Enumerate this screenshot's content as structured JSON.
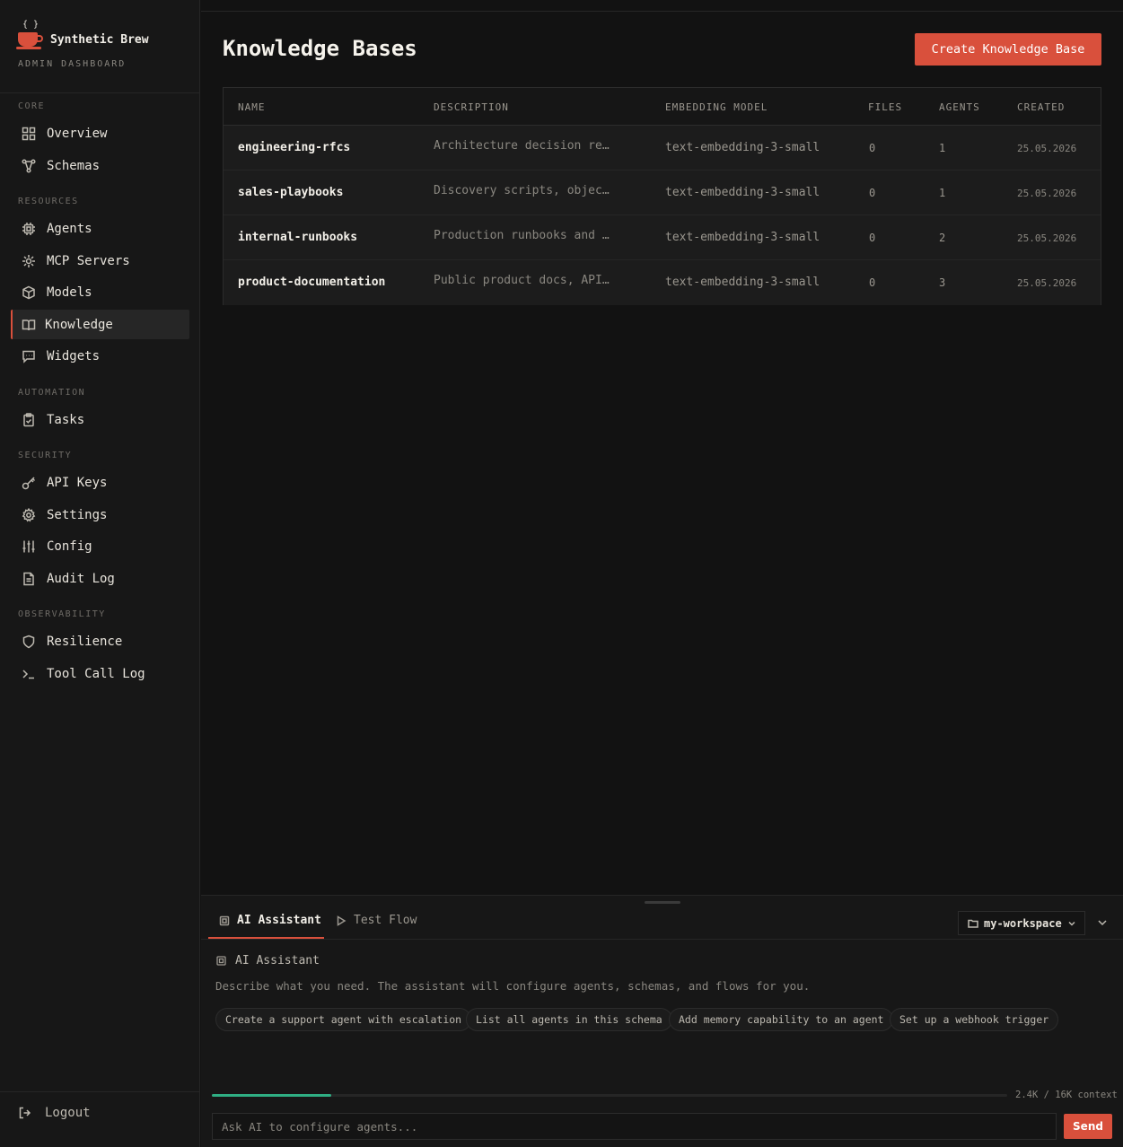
{
  "brand": {
    "braces": "{ }",
    "name": "Synthetic Brew",
    "subtitle": "ADMIN DASHBOARD",
    "accent": "#d9503c"
  },
  "sidebar": {
    "sections": [
      {
        "label": "CORE",
        "items": [
          {
            "label": "Overview",
            "icon": "grid-icon"
          },
          {
            "label": "Schemas",
            "icon": "schema-icon"
          }
        ]
      },
      {
        "label": "RESOURCES",
        "items": [
          {
            "label": "Agents",
            "icon": "cpu-icon"
          },
          {
            "label": "MCP Servers",
            "icon": "plug-icon"
          },
          {
            "label": "Models",
            "icon": "cube-icon"
          },
          {
            "label": "Knowledge",
            "icon": "book-icon",
            "active": true
          },
          {
            "label": "Widgets",
            "icon": "message-icon"
          }
        ]
      },
      {
        "label": "AUTOMATION",
        "items": [
          {
            "label": "Tasks",
            "icon": "clipboard-icon"
          }
        ]
      },
      {
        "label": "SECURITY",
        "items": [
          {
            "label": "API Keys",
            "icon": "key-icon"
          },
          {
            "label": "Settings",
            "icon": "gear-icon"
          },
          {
            "label": "Config",
            "icon": "sliders-icon"
          },
          {
            "label": "Audit Log",
            "icon": "file-icon"
          }
        ]
      },
      {
        "label": "OBSERVABILITY",
        "items": [
          {
            "label": "Resilience",
            "icon": "shield-icon"
          },
          {
            "label": "Tool Call Log",
            "icon": "terminal-icon"
          }
        ]
      }
    ],
    "logout_label": "Logout"
  },
  "page": {
    "title": "Knowledge Bases",
    "create_label": "Create Knowledge Base"
  },
  "table": {
    "columns": [
      "NAME",
      "DESCRIPTION",
      "EMBEDDING MODEL",
      "FILES",
      "AGENTS",
      "CREATED"
    ],
    "rows": [
      {
        "name": "engineering-rfcs",
        "description": "Architecture decision re…",
        "model": "text-embedding-3-small",
        "files": "0",
        "agents": "1",
        "created": "25.05.2026"
      },
      {
        "name": "sales-playbooks",
        "description": "Discovery scripts, objec…",
        "model": "text-embedding-3-small",
        "files": "0",
        "agents": "1",
        "created": "25.05.2026"
      },
      {
        "name": "internal-runbooks",
        "description": "Production runbooks and …",
        "model": "text-embedding-3-small",
        "files": "0",
        "agents": "2",
        "created": "25.05.2026"
      },
      {
        "name": "product-documentation",
        "description": "Public product docs, API…",
        "model": "text-embedding-3-small",
        "files": "0",
        "agents": "3",
        "created": "25.05.2026"
      }
    ]
  },
  "panel": {
    "tabs": [
      {
        "label": "AI Assistant",
        "active": true
      },
      {
        "label": "Test Flow"
      }
    ],
    "workspace": "my-workspace",
    "assistant_title": "AI Assistant",
    "assistant_desc": "Describe what you need. The assistant will configure agents, schemas, and flows for you.",
    "suggestions": [
      "Create a support agent with escalation",
      "List all agents in this schema",
      "Add memory capability to an agent",
      "Set up a webhook trigger"
    ],
    "context_used_fraction": 0.15,
    "context_text": "2.4K / 16K context",
    "input_placeholder": "Ask AI to configure agents...",
    "send_label": "Send"
  }
}
